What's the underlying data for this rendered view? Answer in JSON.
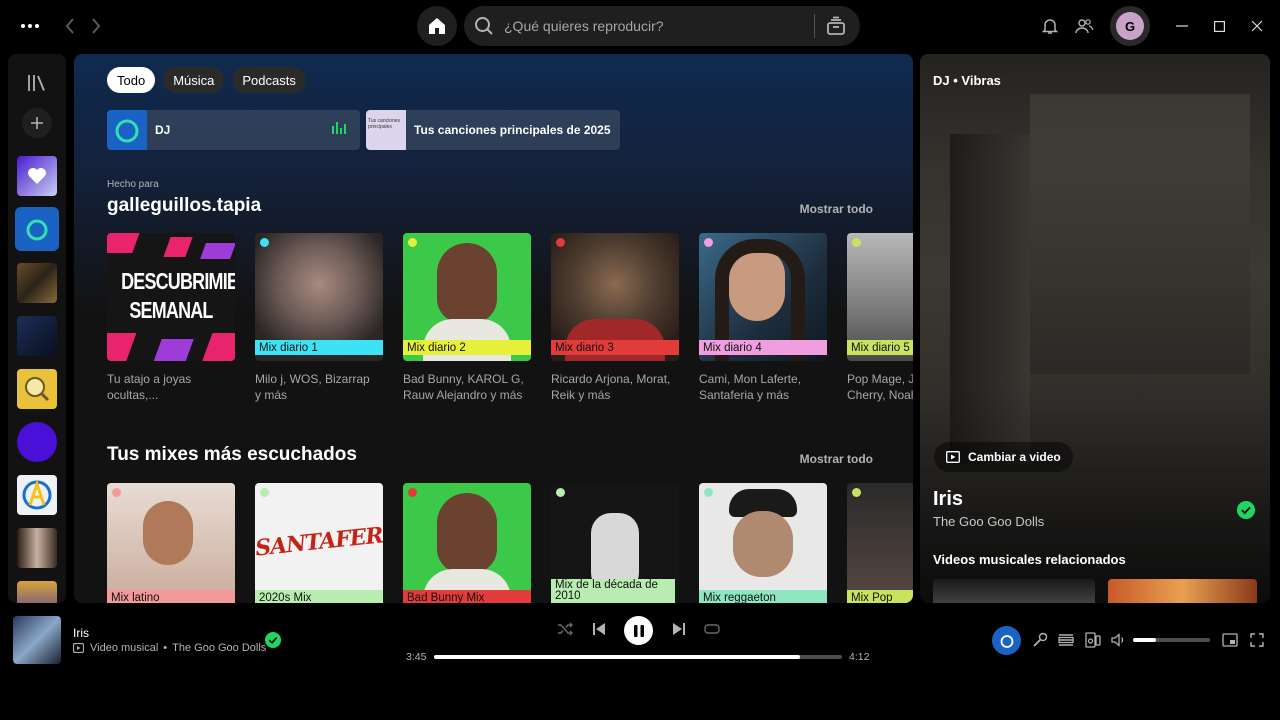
{
  "search": {
    "placeholder": "¿Qué quieres reproducir?"
  },
  "user": {
    "initial": "G"
  },
  "filters": [
    "Todo",
    "Música",
    "Podcasts"
  ],
  "shortcuts": [
    {
      "label": "DJ"
    },
    {
      "label": "Tus canciones principales de 2025",
      "thumb_text": "Tus canciones principales"
    }
  ],
  "made_for": {
    "subtitle": "Hecho para",
    "title": "galleguillos.tapia",
    "show_all": "Mostrar todo",
    "cards": [
      {
        "cover_text": "DESCUBRIMIENTO SEMANAL",
        "band": "",
        "desc_line1": "Tu atajo a joyas",
        "desc_line2": "ocultas,...",
        "band_color": ""
      },
      {
        "band": "Mix diario 1",
        "desc_line1": "Milo j, WOS, Bizarrap",
        "desc_line2": "y más",
        "band_color": "#3de2f4"
      },
      {
        "band": "Mix diario 2",
        "desc_line1": "Bad Bunny, KAROL G,",
        "desc_line2": "Rauw Alejandro y más",
        "band_color": "#e6f03b"
      },
      {
        "band": "Mix diario 3",
        "desc_line1": "Ricardo Arjona, Morat,",
        "desc_line2": "Reik y más",
        "band_color": "#e23b3b"
      },
      {
        "band": "Mix diario 4",
        "desc_line1": "Cami, Mon Laferte,",
        "desc_line2": "Santaferia y más",
        "band_color": "#f09ee0"
      },
      {
        "band": "Mix diario 5",
        "desc_line1": "Pop Mage, Ja",
        "desc_line2": "Cherry, Noah",
        "band_color": "#c9e35f"
      }
    ]
  },
  "top_mixes": {
    "title": "Tus mixes más escuchados",
    "show_all": "Mostrar todo",
    "cards": [
      {
        "band": "Mix latino",
        "band_color": "#f29a9a"
      },
      {
        "band": "2020s Mix",
        "band_color": "#b8ecb0",
        "cover_text": "SANTAFERIA"
      },
      {
        "band": "Bad Bunny Mix",
        "band_color": "#e23b3b"
      },
      {
        "band": "Mix de la década de 2010",
        "band_color": "#b8ecb0"
      },
      {
        "band": "Mix reggaeton",
        "band_color": "#8de6c0"
      },
      {
        "band": "Mix Pop",
        "band_color": "#c9e35f"
      }
    ]
  },
  "now_playing_panel": {
    "header": "DJ • Vibras",
    "switch_label": "Cambiar a video",
    "song": "Iris",
    "artist": "The Goo Goo Dolls",
    "related_title": "Videos musicales relacionados"
  },
  "player": {
    "title": "Iris",
    "type": "Video musical",
    "artist": "The Goo Goo Dolls",
    "elapsed": "3:45",
    "total": "4:12",
    "progress": 0.896,
    "volume": 0.3
  },
  "colors": {
    "accent_green": "#1ed760",
    "dj_blue": "#1a63c5"
  }
}
